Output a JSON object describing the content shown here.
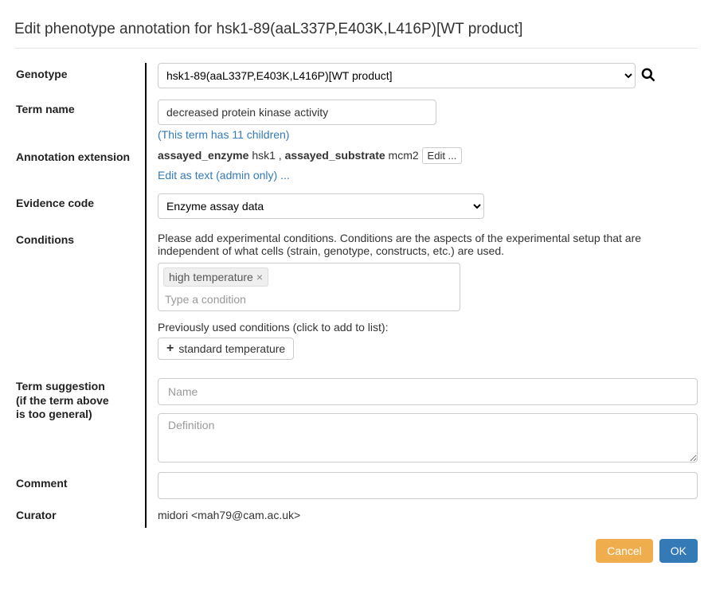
{
  "title": "Edit phenotype annotation for hsk1-89(aaL337P,E403K,L416P)[WT product]",
  "labels": {
    "genotype": "Genotype",
    "term_name": "Term name",
    "annotation_extension": "Annotation extension",
    "evidence_code": "Evidence code",
    "conditions": "Conditions",
    "term_suggestion": "Term suggestion",
    "term_suggestion_sub1": "(if the term above",
    "term_suggestion_sub2": "is too general)",
    "comment": "Comment",
    "curator": "Curator"
  },
  "genotype": {
    "selected": "hsk1-89(aaL337P,E403K,L416P)[WT product]"
  },
  "term": {
    "value": "decreased protein kinase activity",
    "children_link": "(This term has 11 children)"
  },
  "extension": {
    "key1": "assayed_enzyme",
    "val1": "hsk1",
    "sep": " , ",
    "key2": "assayed_substrate",
    "val2": "mcm2",
    "edit_btn": "Edit ...",
    "admin_link": "Edit as text (admin only) ..."
  },
  "evidence": {
    "selected": "Enzyme assay data"
  },
  "conditions": {
    "help": "Please add experimental conditions. Conditions are the aspects of the experimental setup that are independent of what cells (strain, genotype, constructs, etc.) are used.",
    "tag1": "high temperature",
    "placeholder": "Type a condition",
    "prev_label": "Previously used conditions (click to add to list):",
    "prev1": "standard temperature"
  },
  "suggestion": {
    "name_ph": "Name",
    "def_ph": "Definition"
  },
  "comment": {
    "value": ""
  },
  "curator": "midori <mah79@cam.ac.uk>",
  "buttons": {
    "cancel": "Cancel",
    "ok": "OK"
  }
}
